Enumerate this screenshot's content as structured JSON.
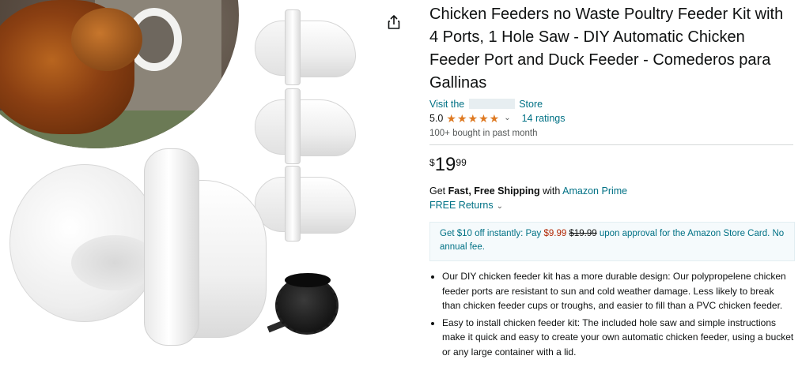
{
  "product": {
    "title": "Chicken Feeders no Waste Poultry Feeder Kit with 4 Ports, 1 Hole Saw - DIY Automatic Chicken Feeder Port and Duck Feeder - Comederos para Gallinas",
    "store_prefix": "Visit the",
    "store_suffix": "Store",
    "rating": "5.0",
    "stars_filled": 5,
    "ratings_count": "14 ratings",
    "bought": "100+ bought in past month"
  },
  "price": {
    "symbol": "$",
    "whole": "19",
    "fraction": "99"
  },
  "shipping": {
    "get": "Get",
    "fast_free": "Fast, Free Shipping",
    "with": "with",
    "prime": "Amazon Prime",
    "returns": "FREE Returns"
  },
  "promo": {
    "part1": "Get $10 off instantly: Pay",
    "new_price": "$9.99",
    "old_price": "$19.99",
    "part2": "upon approval for the Amazon Store Card. No annual fee."
  },
  "bullets": [
    "Our DIY chicken feeder kit has a more durable design: Our polypropelene chicken feeder ports are resistant to sun and cold weather damage. Less likely to break than chicken feeder cups or troughs, and easier to fill than a PVC chicken feeder.",
    "Easy to install chicken feeder kit: The included hole saw and simple instructions make it quick and easy to create your own automatic chicken feeder, using a bucket or any large container with a lid."
  ],
  "icons": {
    "share": "share-icon",
    "star": "star-icon",
    "chevron": "chevron-down-icon"
  },
  "colors": {
    "link": "#007185",
    "star": "#de7921",
    "price_red": "#b12704",
    "text": "#0f1111"
  }
}
